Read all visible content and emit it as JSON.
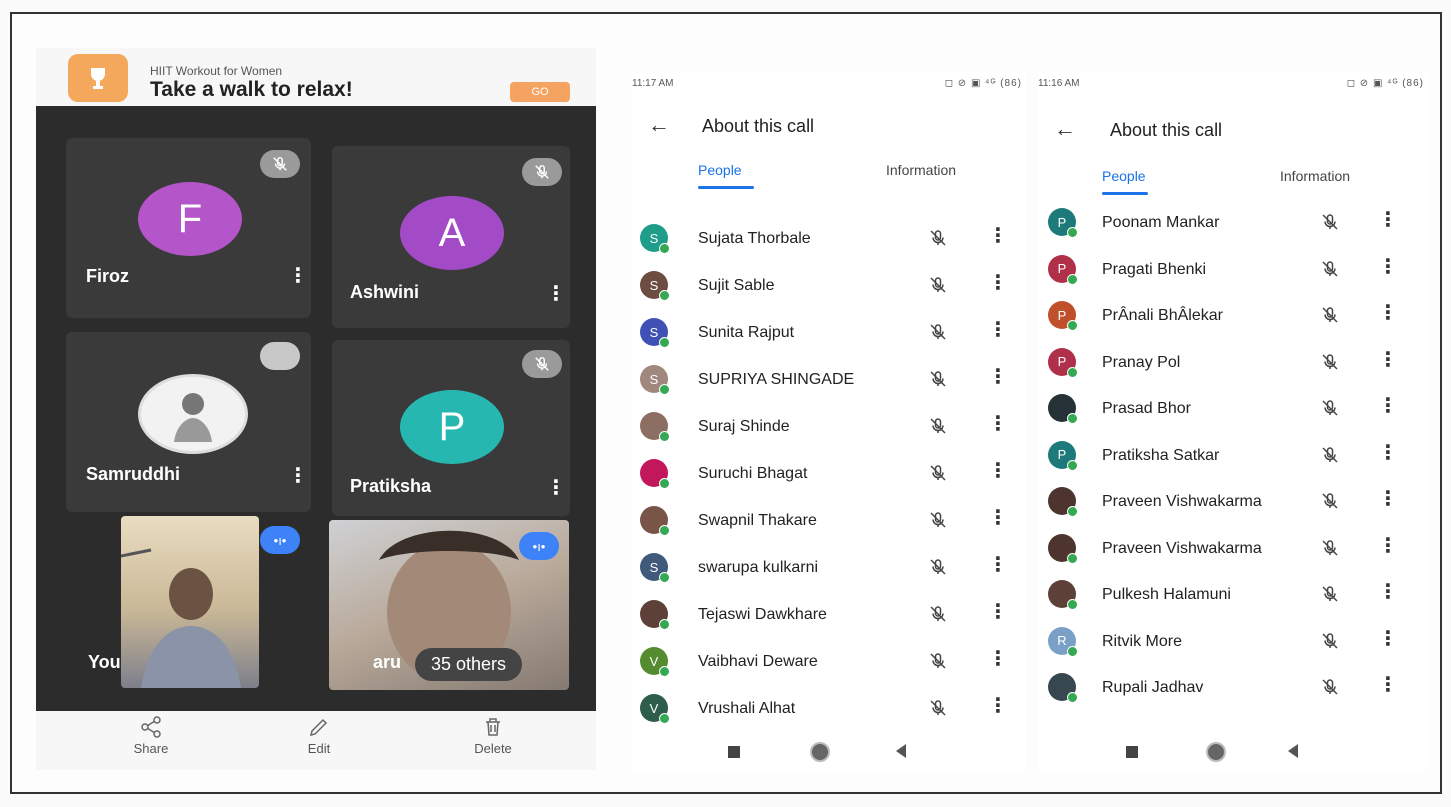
{
  "left": {
    "banner": {
      "app_name": "HIIT Workout for Women",
      "headline": "Take a walk to relax!",
      "go_label": "GO"
    },
    "tiles": [
      {
        "initial": "F",
        "name": "Firoz"
      },
      {
        "initial": "A",
        "name": "Ashwini"
      },
      {
        "initial": "",
        "name": "Samruddhi"
      },
      {
        "initial": "P",
        "name": "Pratiksha"
      },
      {
        "name": "You"
      },
      {
        "name": "aru"
      }
    ],
    "others_label": "35 others",
    "bottom": {
      "share": "Share",
      "edit": "Edit",
      "delete": "Delete"
    }
  },
  "panel1": {
    "time": "11:17 AM",
    "status_icons": "◻ ⊘ ▣ ⁴ᴳ (86)",
    "title": "About this call",
    "tab_people": "People",
    "tab_info": "Information",
    "people": [
      {
        "initial": "S",
        "name": "Sujata Thorbale",
        "color": "#1e9e8a"
      },
      {
        "initial": "S",
        "name": "Sujit Sable",
        "color": "#6d4c41"
      },
      {
        "initial": "S",
        "name": "Sunita Rajput",
        "color": "#3f51b5"
      },
      {
        "initial": "S",
        "name": "SUPRIYA SHINGADE",
        "color": "#a1887f"
      },
      {
        "initial": "",
        "name": "Suraj Shinde",
        "color": "#8d6e63"
      },
      {
        "initial": "",
        "name": "Suruchi Bhagat",
        "color": "#c2185b"
      },
      {
        "initial": "",
        "name": "Swapnil Thakare",
        "color": "#795548"
      },
      {
        "initial": "S",
        "name": "swarupa kulkarni",
        "color": "#3f5a7a"
      },
      {
        "initial": "",
        "name": "Tejaswi Dawkhare",
        "color": "#5d4037"
      },
      {
        "initial": "V",
        "name": "Vaibhavi Deware",
        "color": "#558b2f"
      },
      {
        "initial": "V",
        "name": "Vrushali Alhat",
        "color": "#2e5d4b"
      }
    ]
  },
  "panel2": {
    "time": "11:16 AM",
    "status_icons": "◻ ⊘ ▣ ⁴ᴳ (86)",
    "title": "About this call",
    "tab_people": "People",
    "tab_info": "Information",
    "people": [
      {
        "initial": "P",
        "name": "Poonam Mankar",
        "color": "#1e7a7a"
      },
      {
        "initial": "P",
        "name": "Pragati Bhenki",
        "color": "#b0304a"
      },
      {
        "initial": "P",
        "name": "PrÂnali BhÂlekar",
        "color": "#c0502a"
      },
      {
        "initial": "P",
        "name": "Pranay Pol",
        "color": "#b0304a"
      },
      {
        "initial": "",
        "name": "Prasad Bhor",
        "color": "#263238"
      },
      {
        "initial": "P",
        "name": "Pratiksha Satkar",
        "color": "#1e7a7a"
      },
      {
        "initial": "",
        "name": "Praveen Vishwakarma",
        "color": "#4e342e"
      },
      {
        "initial": "",
        "name": "Praveen Vishwakarma",
        "color": "#4e342e"
      },
      {
        "initial": "",
        "name": "Pulkesh Halamuni",
        "color": "#5d4037"
      },
      {
        "initial": "R",
        "name": "Ritvik More",
        "color": "#7aa0c8"
      },
      {
        "initial": "",
        "name": "Rupali Jadhav",
        "color": "#37474f"
      }
    ]
  }
}
